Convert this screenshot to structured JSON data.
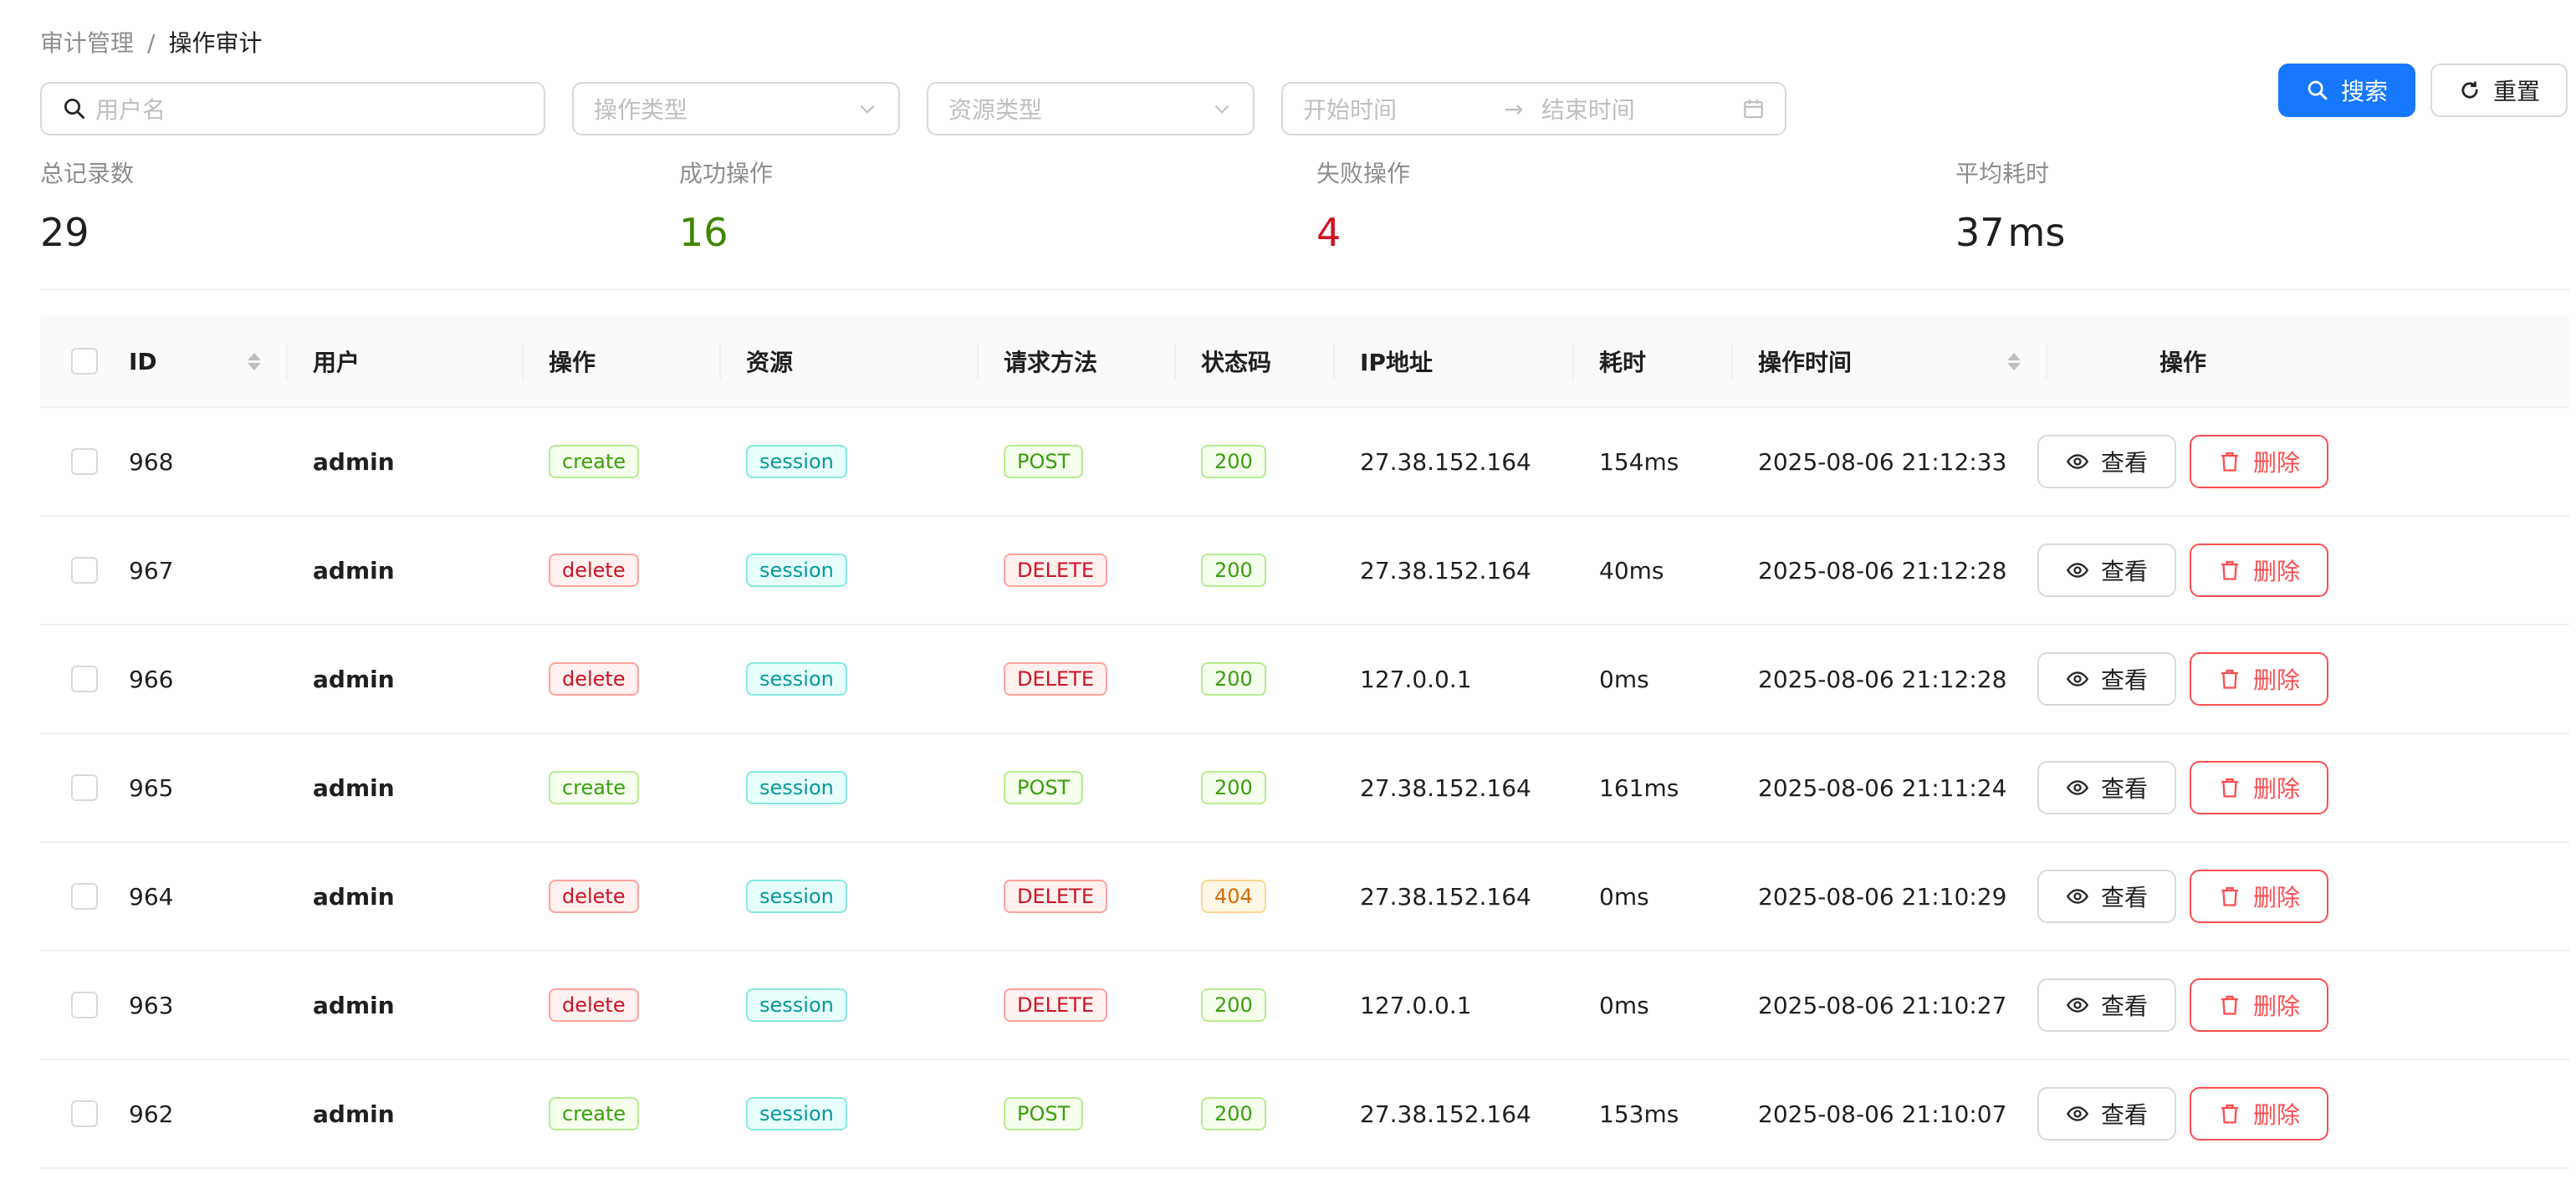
{
  "breadcrumb": {
    "parent": "审计管理",
    "separator": "/",
    "current": "操作审计"
  },
  "filters": {
    "username_placeholder": "用户名",
    "op_type_placeholder": "操作类型",
    "res_type_placeholder": "资源类型",
    "start_placeholder": "开始时间",
    "end_placeholder": "结束时间",
    "date_arrow": "→"
  },
  "buttons": {
    "search": "搜索",
    "reset": "重置"
  },
  "stats": {
    "total": {
      "label": "总记录数",
      "value": "29"
    },
    "success": {
      "label": "成功操作",
      "value": "16"
    },
    "failed": {
      "label": "失败操作",
      "value": "4"
    },
    "avg": {
      "label": "平均耗时",
      "value": "37",
      "unit": "ms"
    }
  },
  "table": {
    "headers": {
      "id": "ID",
      "user": "用户",
      "op": "操作",
      "res": "资源",
      "method": "请求方法",
      "status": "状态码",
      "ip": "IP地址",
      "time": "耗时",
      "date": "操作时间",
      "actions": "操作"
    },
    "row_actions": {
      "view": "查看",
      "delete": "删除"
    },
    "rows": [
      {
        "id": "968",
        "user": "admin",
        "op": "create",
        "res": "session",
        "method": "POST",
        "status": "200",
        "ip": "27.38.152.164",
        "time": "154ms",
        "date": "2025-08-06 21:12:33"
      },
      {
        "id": "967",
        "user": "admin",
        "op": "delete",
        "res": "session",
        "method": "DELETE",
        "status": "200",
        "ip": "27.38.152.164",
        "time": "40ms",
        "date": "2025-08-06 21:12:28"
      },
      {
        "id": "966",
        "user": "admin",
        "op": "delete",
        "res": "session",
        "method": "DELETE",
        "status": "200",
        "ip": "127.0.0.1",
        "time": "0ms",
        "date": "2025-08-06 21:12:28"
      },
      {
        "id": "965",
        "user": "admin",
        "op": "create",
        "res": "session",
        "method": "POST",
        "status": "200",
        "ip": "27.38.152.164",
        "time": "161ms",
        "date": "2025-08-06 21:11:24"
      },
      {
        "id": "964",
        "user": "admin",
        "op": "delete",
        "res": "session",
        "method": "DELETE",
        "status": "404",
        "ip": "27.38.152.164",
        "time": "0ms",
        "date": "2025-08-06 21:10:29"
      },
      {
        "id": "963",
        "user": "admin",
        "op": "delete",
        "res": "session",
        "method": "DELETE",
        "status": "200",
        "ip": "127.0.0.1",
        "time": "0ms",
        "date": "2025-08-06 21:10:27"
      },
      {
        "id": "962",
        "user": "admin",
        "op": "create",
        "res": "session",
        "method": "POST",
        "status": "200",
        "ip": "27.38.152.164",
        "time": "153ms",
        "date": "2025-08-06 21:10:07"
      }
    ]
  },
  "colors": {
    "primary": "#1677ff",
    "success": "#3f8600",
    "danger": "#cf1322",
    "delete_button": "#ff4d4f"
  }
}
